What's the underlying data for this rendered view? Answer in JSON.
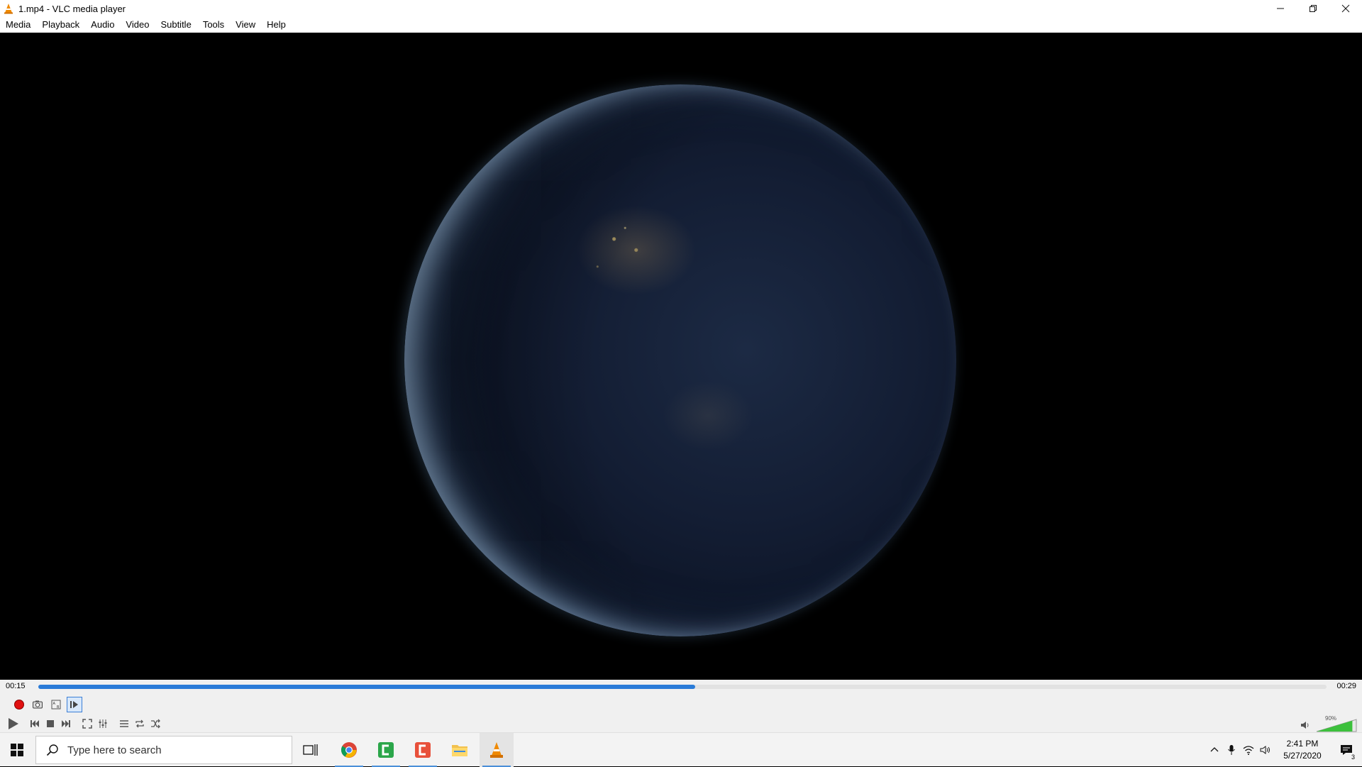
{
  "window": {
    "title": "1.mp4 - VLC media player",
    "minimize_icon": "minimize-icon",
    "maximize_icon": "restore-icon",
    "close_icon": "close-icon"
  },
  "menu": {
    "items": [
      {
        "label": "Media"
      },
      {
        "label": "Playback"
      },
      {
        "label": "Audio"
      },
      {
        "label": "Video"
      },
      {
        "label": "Subtitle"
      },
      {
        "label": "Tools"
      },
      {
        "label": "View"
      },
      {
        "label": "Help"
      }
    ]
  },
  "player": {
    "elapsed": "00:15",
    "total": "00:29",
    "progress_fraction": 0.51,
    "volume_percent": "90%",
    "volume_fraction": 0.9,
    "colors": {
      "seek_fill": "#2a7bd8",
      "record_red": "#e01010",
      "volume_green": "#3cc03c"
    }
  },
  "taskbar": {
    "search_placeholder": "Type here to search",
    "time": "2:41 PM",
    "date": "5/27/2020",
    "notification_count": "3"
  }
}
